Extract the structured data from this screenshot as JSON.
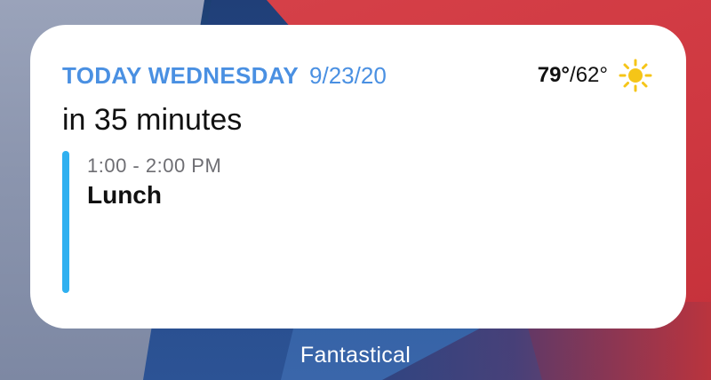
{
  "widget": {
    "day_label": "TODAY WEDNESDAY",
    "date": "9/23/20",
    "weather": {
      "high": "79°",
      "separator": "/",
      "low": "62°",
      "icon": "sun-icon"
    },
    "countdown": "in 35 minutes",
    "event": {
      "time": "1:00 - 2:00 PM",
      "title": "Lunch",
      "calendar_color": "#2fb0f0"
    }
  },
  "app_name": "Fantastical",
  "colors": {
    "accent": "#4a90e2",
    "sun": "#f5c518"
  }
}
